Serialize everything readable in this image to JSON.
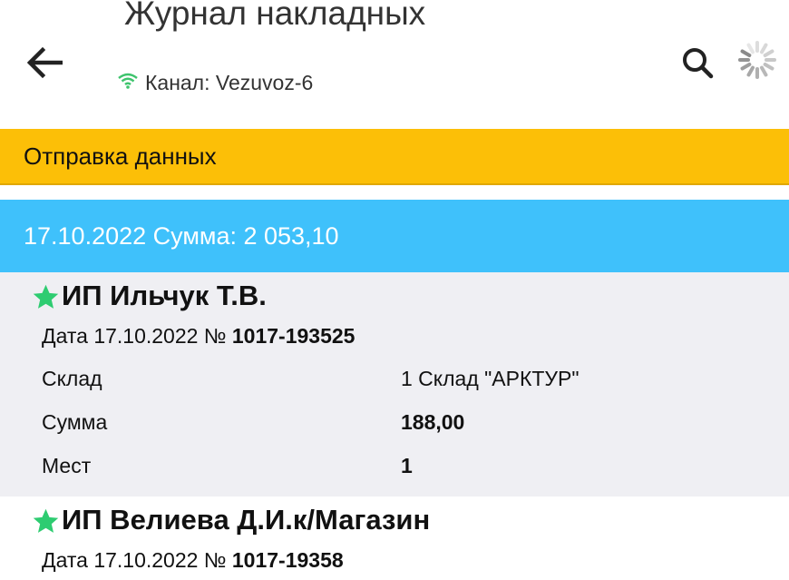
{
  "header": {
    "title": "Журнал накладных",
    "channel_label": "Канал: Vezuvoz-6",
    "icons": {
      "back": "arrow-left-icon",
      "search": "search-icon",
      "loading": "spinner-icon",
      "wifi": "wifi-icon"
    }
  },
  "sync_bar": {
    "text": "Отправка данных",
    "color": "#fcbf07"
  },
  "date_group": {
    "text": "17.10.2022 Сумма: 2 053,10",
    "color": "#3fc1fb"
  },
  "documents": [
    {
      "customer": "ИП Ильчук Т.В.",
      "doc_prefix": "Дата 17.10.2022 №",
      "doc_number": "1017-193525",
      "fields": [
        {
          "label": "Склад",
          "value": "1 Склад \"АРКТУР\""
        },
        {
          "label": "Сумма",
          "value": "188,00"
        },
        {
          "label": "Мест",
          "value": "1"
        }
      ]
    },
    {
      "customer": "ИП Велиева Д.И.к/Магазин",
      "doc_prefix": "Дата 17.10.2022 №",
      "doc_number": "1017-19358"
    }
  ]
}
